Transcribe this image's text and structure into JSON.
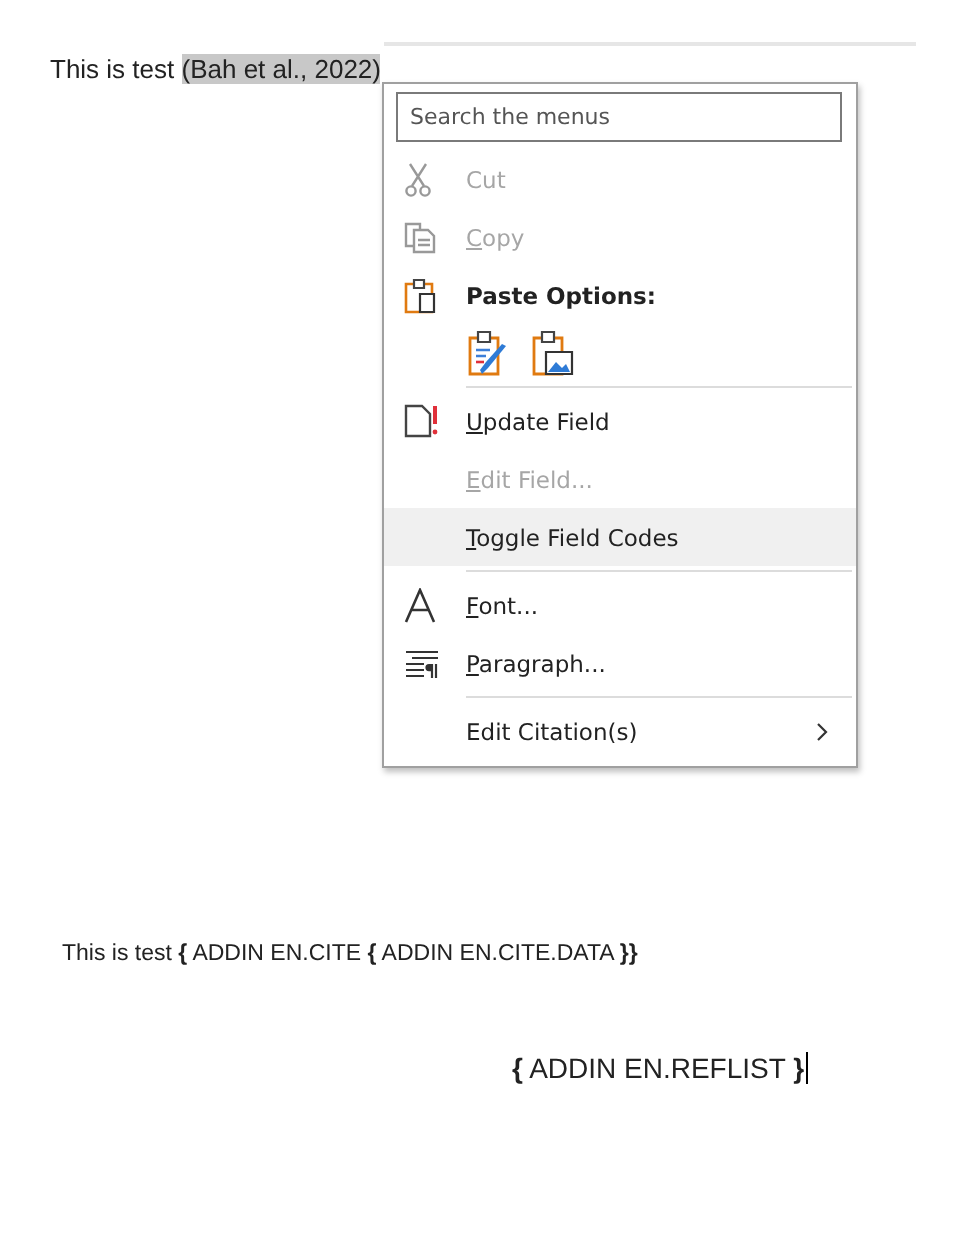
{
  "document": {
    "line_1": {
      "text": "This is test ",
      "citation": "(Bah et al., 2022)",
      "citation_selected": true
    },
    "line_2": "This is test **{** ADDIN EN.CITE **{** ADDIN EN.CITE.DATA **}}**",
    "line_3": "**{** ADDIN EN.REFLIST **}**"
  },
  "context_menu": {
    "search": {
      "placeholder": "Search the menus"
    },
    "items": [
      {
        "kind": "command",
        "label": "Cut",
        "first_letter_underlined": false,
        "disabled": true,
        "selected": false
      },
      {
        "kind": "command",
        "label": "Copy",
        "first_letter_underlined": true,
        "disabled": true,
        "selected": false
      },
      {
        "kind": "header",
        "label": "Paste Options:"
      },
      {
        "kind": "paste-icons"
      },
      {
        "kind": "separator"
      },
      {
        "kind": "command",
        "label": "Update Field",
        "first_letter_underlined": true,
        "disabled": false,
        "selected": false
      },
      {
        "kind": "command",
        "label": "Edit Field...",
        "first_letter_underlined": true,
        "disabled": true,
        "selected": false
      },
      {
        "kind": "command",
        "label": "Toggle Field Codes",
        "first_letter_underlined": true,
        "disabled": false,
        "selected": true
      },
      {
        "kind": "separator"
      },
      {
        "kind": "command",
        "label": "Font...",
        "first_letter_underlined": true,
        "disabled": false,
        "selected": false
      },
      {
        "kind": "command",
        "label": "Paragraph...",
        "first_letter_underlined": true,
        "disabled": false,
        "selected": false
      },
      {
        "kind": "separator"
      },
      {
        "kind": "submenu",
        "label": "Edit Citation(s)",
        "disabled": false,
        "selected": false
      }
    ]
  }
}
